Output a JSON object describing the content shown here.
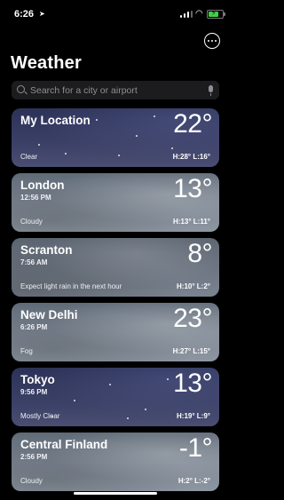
{
  "status_bar": {
    "time": "6:26",
    "location_icon": "location-arrow-icon",
    "wifi_icon": "wifi-icon",
    "battery_icon": "battery-charging-icon",
    "battery_color": "#3fd04a"
  },
  "header": {
    "title": "Weather",
    "more_icon": "ellipsis-circle-icon"
  },
  "search": {
    "placeholder": "Search for a city or airport",
    "search_icon": "search-icon",
    "mic_icon": "microphone-icon"
  },
  "cities": [
    {
      "name": "My Location",
      "time": "",
      "condition": "Clear",
      "temp": "22°",
      "hilo": "H:28°  L:16°",
      "style": "night"
    },
    {
      "name": "London",
      "time": "12:56 PM",
      "condition": "Cloudy",
      "temp": "13°",
      "hilo": "H:13°  L:11°",
      "style": "cloudy"
    },
    {
      "name": "Scranton",
      "time": "7:56 AM",
      "condition": "Expect light rain in the next hour",
      "temp": "8°",
      "hilo": "H:10°  L:2°",
      "style": "rain"
    },
    {
      "name": "New Delhi",
      "time": "6:26 PM",
      "condition": "Fog",
      "temp": "23°",
      "hilo": "H:27°  L:15°",
      "style": "cloudy"
    },
    {
      "name": "Tokyo",
      "time": "9:56 PM",
      "condition": "Mostly Clear",
      "temp": "13°",
      "hilo": "H:19°  L:9°",
      "style": "night"
    },
    {
      "name": "Central Finland",
      "time": "2:56 PM",
      "condition": "Cloudy",
      "temp": "-1°",
      "hilo": "H:2°  L:-2°",
      "style": "cloudy"
    }
  ]
}
